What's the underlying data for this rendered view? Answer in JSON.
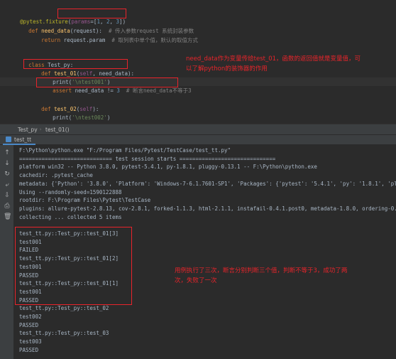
{
  "editor": {
    "line1": {
      "deco": "@pytest.fixture",
      "open": "(",
      "param_kw": "params",
      "eq": "=",
      "list_open": "[",
      "n1": "1",
      "c1": ", ",
      "n2": "2",
      "c2": ", ",
      "n3": "3",
      "list_close": "]",
      "close": ")"
    },
    "line2": {
      "kw": "def ",
      "name": "need_data",
      "args": "(request):  ",
      "comment": "# 传入参数request 系统封装参数"
    },
    "line3": {
      "kw": "return ",
      "body": "request.param  ",
      "comment": "# 取列表中单个值，默认的取值方式"
    },
    "line6": {
      "kw": "class ",
      "name": "Test_py:"
    },
    "line7": {
      "kw": "def ",
      "name": "test_01",
      "args_open": "(",
      "self": "self",
      "args_rest": ", need_data):"
    },
    "line8": {
      "text": "print(",
      "str": "'\\ntest001'",
      "close": ")"
    },
    "line9": {
      "kw": "assert ",
      "body": "need_data != ",
      "num": "3",
      "pad": "  ",
      "comment": "# 断言need_data不等于3"
    },
    "line11": {
      "kw": "def ",
      "name": "test_02",
      "args_open": "(",
      "self": "self",
      "args_rest": "):"
    },
    "line12": {
      "text": "print(",
      "str": "'\\ntest002'",
      "close": ")"
    }
  },
  "annotations": {
    "editor_note": "need_data作为变量传给test_01，函数的返回值就是变量值，可\n以了解python的装饰器的作用",
    "console_note": "用例执行了三次，断言分别判断三个值，判断不等于3，成功了两\n次，失败了一次"
  },
  "breadcrumb": {
    "item1": "Test_py",
    "sep": "›",
    "item2": "test_01()"
  },
  "run_tab": {
    "label": "test_tt"
  },
  "console": {
    "lines": [
      "F:\\Python\\python.exe \"F:/Program Files/Pytest/TestCase/test_tt.py\"",
      "============================= test session starts ==============================",
      "platform win32 -- Python 3.8.0, pytest-5.4.1, py-1.8.1, pluggy-0.13.1 -- F:\\Python\\python.exe",
      "cachedir: .pytest_cache",
      "metadata: {'Python': '3.8.0', 'Platform': 'Windows-7-6.1.7601-SP1', 'Packages': {'pytest': '5.4.1', 'py': '1.8.1', 'pluggy': '0.1",
      "Using --randomly-seed=1590122888",
      "rootdir: F:\\Program Files\\Pytest\\TestCase",
      "plugins: allure-pytest-2.8.13, cov-2.8.1, forked-1.1.3, html-2.1.1, instafail-0.4.1.post0, metadata-1.8.0, ordering-0.6, randomly",
      "collecting ... collected 5 items",
      "",
      "test_tt.py::Test_py::test_01[3]",
      "test001",
      "FAILED",
      "test_tt.py::Test_py::test_01[2]",
      "test001",
      "PASSED",
      "test_tt.py::Test_py::test_01[1]",
      "test001",
      "PASSED",
      "test_tt.py::Test_py::test_02",
      "test002",
      "PASSED",
      "test_tt.py::Test_py::test_03",
      "test003",
      "PASSED"
    ]
  },
  "icons": [
    "up-arrow-icon",
    "down-arrow-icon",
    "rerun-icon",
    "soft-wrap-icon",
    "scroll-to-end-icon",
    "print-icon",
    "delete-icon"
  ]
}
